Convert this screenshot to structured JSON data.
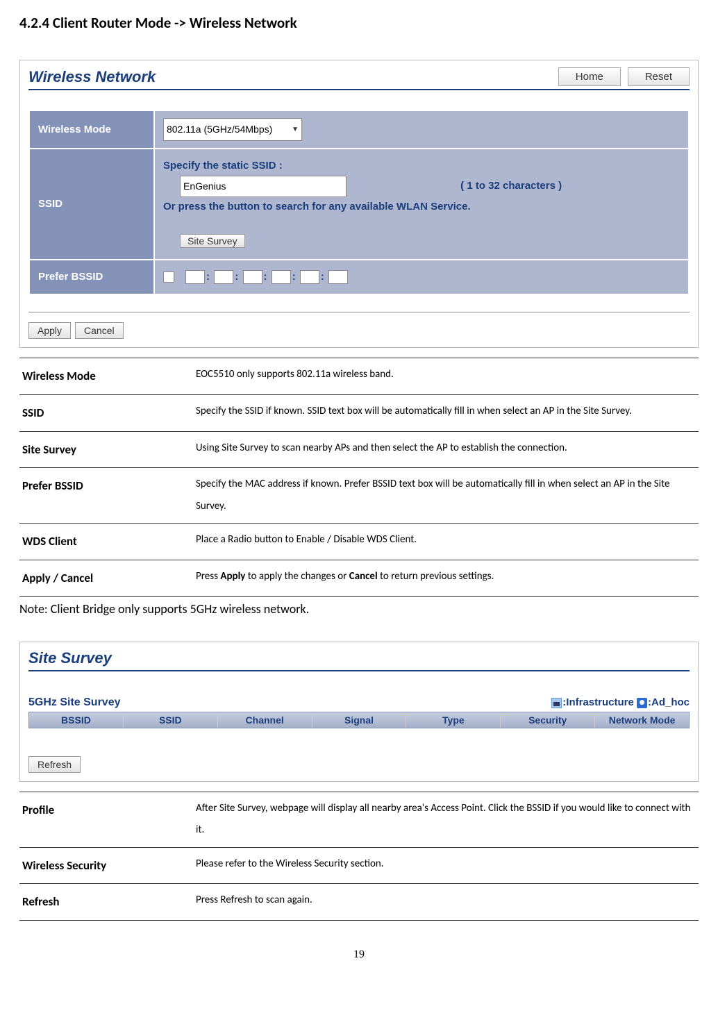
{
  "heading": "4.2.4 Client Router Mode -> Wireless Network",
  "panel1": {
    "title": "Wireless Network",
    "home_btn": "Home",
    "reset_btn": "Reset",
    "wireless_mode_label": "Wireless Mode",
    "wireless_mode_value": "802.11a (5GHz/54Mbps)",
    "ssid_label": "SSID",
    "ssid_line1": "Specify the static SSID  :",
    "ssid_value": "EnGenius",
    "ssid_hint": "( 1 to 32 characters )",
    "ssid_line2": "Or press the button to search for any available WLAN Service.",
    "site_survey_btn": "Site Survey",
    "prefer_bssid_label": "Prefer BSSID",
    "apply_btn": "Apply",
    "cancel_btn": "Cancel"
  },
  "desc1": [
    {
      "term": "Wireless Mode",
      "def": "EOC5510 only supports 802.11a wireless band."
    },
    {
      "term": "SSID",
      "def": "Specify the SSID if known. SSID text box will be automatically fill in when select an AP in the Site Survey."
    },
    {
      "term": "Site Survey",
      "def": "Using Site Survey to scan nearby APs and then select the AP to establish the connection."
    },
    {
      "term": "Prefer BSSID",
      "def": "Specify the MAC address if known. Prefer BSSID text box will be automatically fill in when select an AP in the Site Survey."
    },
    {
      "term": "WDS Client",
      "def": "Place a Radio button to Enable / Disable WDS Client."
    },
    {
      "term": "Apply / Cancel",
      "def_prefix": "Press ",
      "def_b1": "Apply",
      "def_mid": " to apply the changes or ",
      "def_b2": "Cancel",
      "def_suffix": " to return previous settings."
    }
  ],
  "note": "Note: Client Bridge only supports 5GHz wireless network.",
  "panel2": {
    "title": "Site Survey",
    "subhead": "5GHz Site Survey",
    "legend_infra": ":Infrastructure",
    "legend_adhoc": ":Ad_hoc",
    "columns": [
      "BSSID",
      "SSID",
      "Channel",
      "Signal",
      "Type",
      "Security",
      "Network Mode"
    ],
    "refresh_btn": "Refresh"
  },
  "desc2": [
    {
      "term": "Profile",
      "def": "After Site Survey, webpage will display all nearby area's Access Point. Click the BSSID if you would like to connect with it."
    },
    {
      "term": "Wireless Security",
      "def": "Please refer to the Wireless Security section."
    },
    {
      "term": "Refresh",
      "def": "Press Refresh to scan again."
    }
  ],
  "page_number": "19"
}
